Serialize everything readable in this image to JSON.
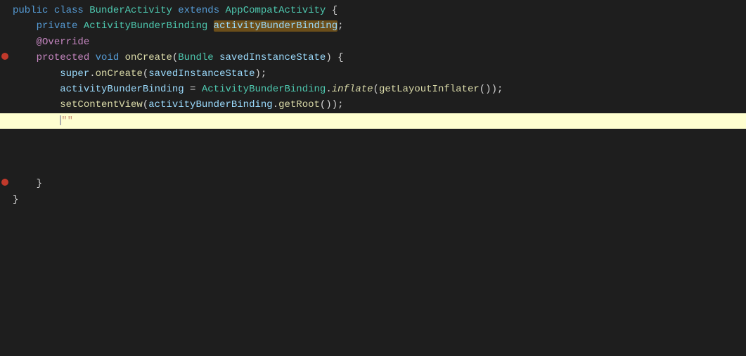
{
  "editor": {
    "background": "#1e1e1e",
    "lines": [
      {
        "id": 1,
        "indent": 0,
        "highlighted": false,
        "has_left_dot": false,
        "tokens": [
          {
            "type": "kw-blue",
            "text": "public"
          },
          {
            "type": "plain",
            "text": " "
          },
          {
            "type": "kw-blue",
            "text": "class"
          },
          {
            "type": "plain",
            "text": " "
          },
          {
            "type": "class-name",
            "text": "BunderActivity"
          },
          {
            "type": "plain",
            "text": " "
          },
          {
            "type": "kw-blue",
            "text": "extends"
          },
          {
            "type": "plain",
            "text": " "
          },
          {
            "type": "class-name",
            "text": "AppCompatActivity"
          },
          {
            "type": "plain",
            "text": " {"
          }
        ]
      },
      {
        "id": 2,
        "indent": 1,
        "highlighted": false,
        "has_left_dot": false,
        "tokens": [
          {
            "type": "plain",
            "text": "    "
          },
          {
            "type": "kw-blue",
            "text": "private"
          },
          {
            "type": "plain",
            "text": " "
          },
          {
            "type": "class-name",
            "text": "ActivityBunderBinding"
          },
          {
            "type": "plain",
            "text": " "
          },
          {
            "type": "variable-highlight",
            "text": "activityBunderBinding"
          },
          {
            "type": "plain",
            "text": ";"
          }
        ]
      },
      {
        "id": 3,
        "indent": 1,
        "highlighted": false,
        "has_left_dot": false,
        "tokens": [
          {
            "type": "plain",
            "text": "    "
          },
          {
            "type": "kw-purple",
            "text": "@Override"
          }
        ]
      },
      {
        "id": 4,
        "indent": 1,
        "highlighted": false,
        "has_left_dot": true,
        "tokens": [
          {
            "type": "plain",
            "text": "    "
          },
          {
            "type": "kw-purple",
            "text": "protected"
          },
          {
            "type": "plain",
            "text": " "
          },
          {
            "type": "kw-blue",
            "text": "void"
          },
          {
            "type": "plain",
            "text": " "
          },
          {
            "type": "method-name",
            "text": "onCreate"
          },
          {
            "type": "plain",
            "text": "("
          },
          {
            "type": "class-name",
            "text": "Bundle"
          },
          {
            "type": "plain",
            "text": " "
          },
          {
            "type": "variable",
            "text": "savedInstanceState"
          },
          {
            "type": "plain",
            "text": ") {"
          }
        ]
      },
      {
        "id": 5,
        "indent": 2,
        "highlighted": false,
        "has_left_dot": false,
        "tokens": [
          {
            "type": "plain",
            "text": "        "
          },
          {
            "type": "variable",
            "text": "super"
          },
          {
            "type": "plain",
            "text": "."
          },
          {
            "type": "method-name",
            "text": "onCreate"
          },
          {
            "type": "plain",
            "text": "("
          },
          {
            "type": "variable",
            "text": "savedInstanceState"
          },
          {
            "type": "plain",
            "text": ");"
          }
        ]
      },
      {
        "id": 6,
        "indent": 2,
        "highlighted": false,
        "has_left_dot": false,
        "tokens": [
          {
            "type": "plain",
            "text": "        "
          },
          {
            "type": "variable",
            "text": "activityBunderBinding"
          },
          {
            "type": "plain",
            "text": " = "
          },
          {
            "type": "class-name",
            "text": "ActivityBunderBinding"
          },
          {
            "type": "plain",
            "text": "."
          },
          {
            "type": "method-name-italic",
            "text": "inflate"
          },
          {
            "type": "plain",
            "text": "("
          },
          {
            "type": "method-name",
            "text": "getLayoutInflater"
          },
          {
            "type": "plain",
            "text": "());"
          }
        ]
      },
      {
        "id": 7,
        "indent": 2,
        "highlighted": false,
        "has_left_dot": false,
        "tokens": [
          {
            "type": "plain",
            "text": "        "
          },
          {
            "type": "method-name",
            "text": "setContentView"
          },
          {
            "type": "plain",
            "text": "("
          },
          {
            "type": "variable",
            "text": "activityBunderBinding"
          },
          {
            "type": "plain",
            "text": "."
          },
          {
            "type": "method-name",
            "text": "getRoot"
          },
          {
            "type": "plain",
            "text": "());"
          }
        ]
      },
      {
        "id": 8,
        "indent": 2,
        "highlighted": true,
        "has_left_dot": false,
        "tokens": [
          {
            "type": "plain",
            "text": "        "
          },
          {
            "type": "cursor",
            "text": ""
          },
          {
            "type": "string",
            "text": "\"\""
          }
        ]
      },
      {
        "id": 9,
        "indent": 0,
        "highlighted": false,
        "has_left_dot": false,
        "tokens": []
      },
      {
        "id": 10,
        "indent": 0,
        "highlighted": false,
        "has_left_dot": false,
        "tokens": []
      },
      {
        "id": 11,
        "indent": 0,
        "highlighted": false,
        "has_left_dot": false,
        "tokens": []
      },
      {
        "id": 12,
        "indent": 1,
        "highlighted": false,
        "has_left_dot": false,
        "tokens": [
          {
            "type": "plain",
            "text": "    "
          },
          {
            "type": "plain",
            "text": "}"
          }
        ]
      },
      {
        "id": 13,
        "indent": 0,
        "highlighted": false,
        "has_left_dot": false,
        "tokens": [
          {
            "type": "plain",
            "text": "}"
          }
        ]
      }
    ]
  }
}
